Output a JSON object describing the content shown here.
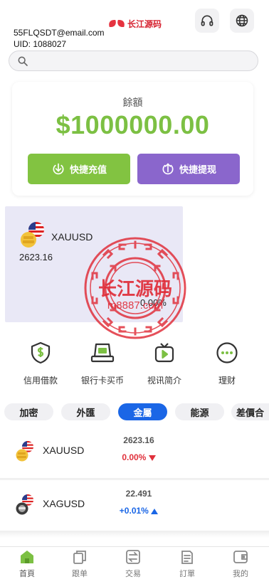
{
  "header": {
    "logo_text": "长江源码",
    "email": "55FLQSDT@email.com",
    "uid": "UID: 1088027",
    "headset_icon": "headset-icon",
    "globe_icon": "globe-icon"
  },
  "search": {
    "placeholder": "",
    "value": ""
  },
  "balance": {
    "label": "餘額",
    "amount": "$1000000.00",
    "deposit_label": "快捷充值",
    "withdraw_label": "快捷提现",
    "colors": {
      "amount": "#7cc043",
      "deposit": "#82c341",
      "withdraw": "#8a66cc"
    }
  },
  "featured": {
    "symbol": "XAUUSD",
    "price": "2623.16",
    "change": "0.00%"
  },
  "watermark": {
    "text_cn": "长江源码",
    "text_url": "m8887.com",
    "color": "#e02a36"
  },
  "quick_menu": [
    {
      "label": "信用借款",
      "icon": "shield-dollar-icon"
    },
    {
      "label": "银行卡买币",
      "icon": "card-terminal-icon"
    },
    {
      "label": "视讯简介",
      "icon": "video-play-icon"
    },
    {
      "label": "理财",
      "icon": "more-dots-icon"
    }
  ],
  "tabs": [
    {
      "label": "加密",
      "active": false
    },
    {
      "label": "外匯",
      "active": false
    },
    {
      "label": "金屬",
      "active": true
    },
    {
      "label": "能源",
      "active": false
    },
    {
      "label": "差價合",
      "active": false
    }
  ],
  "markets": [
    {
      "symbol": "XAUUSD",
      "price": "2623.16",
      "change": "0.00%",
      "direction": "down"
    },
    {
      "symbol": "XAGUSD",
      "price": "22.491",
      "change": "+0.01%",
      "direction": "up"
    }
  ],
  "bottom_nav": [
    {
      "label": "首頁",
      "icon": "home-icon",
      "active": true
    },
    {
      "label": "跟单",
      "icon": "copy-icon",
      "active": false
    },
    {
      "label": "交易",
      "icon": "exchange-icon",
      "active": false
    },
    {
      "label": "訂單",
      "icon": "orders-icon",
      "active": false
    },
    {
      "label": "我的",
      "icon": "wallet-icon",
      "active": false
    }
  ],
  "accent_colors": {
    "primary_blue": "#1a66e6",
    "down_red": "#e0303b",
    "up_blue": "#1a66e6"
  }
}
